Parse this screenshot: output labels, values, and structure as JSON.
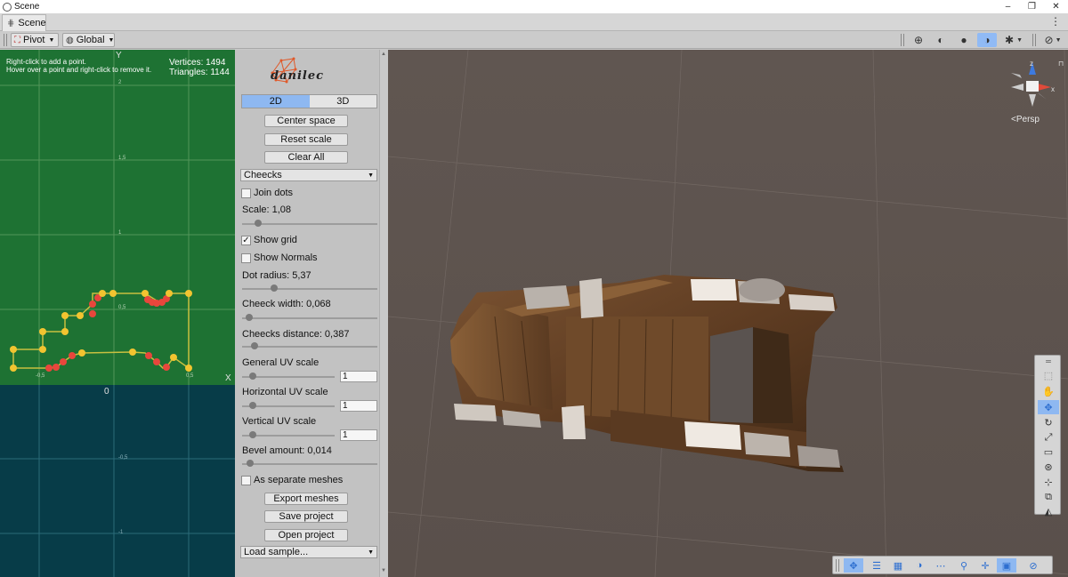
{
  "window": {
    "title": "Scene",
    "buttons": [
      "–",
      "❐",
      "✕"
    ]
  },
  "tab": {
    "label": "Scene",
    "icon": "grid-icon",
    "menu_icon": "⋮"
  },
  "toolbar": {
    "pivot": "Pivot",
    "global": "Global",
    "right_icons": [
      "globe-icon",
      "shaded-sphere-icon",
      "sphere-icon",
      "skybox-icon",
      "gizmo-icon",
      "camera-icon"
    ]
  },
  "editor2d": {
    "hint_line1": "Right-click to add a point.",
    "hint_line2": "Hover over a point and right-click to remove it.",
    "vertices": "Vertices: 1494",
    "triangles": "Triangles: 1144",
    "axis_x": "X",
    "axis_y": "Y",
    "origin": "0",
    "ticks": [
      "2",
      "1,5",
      "1",
      "0,5",
      "-0,5",
      "0,5",
      "-0,5",
      "-1"
    ],
    "colors": {
      "upper": "#1e7233",
      "lower": "#073c48",
      "grid": "#6aa46a",
      "point": "#f2c430",
      "point_red": "#e8463c",
      "line": "#c8c040"
    }
  },
  "panel": {
    "logo": "danilec",
    "mode_2d": "2D",
    "mode_3d": "3D",
    "center_space": "Center space",
    "reset_scale": "Reset scale",
    "clear_all": "Clear All",
    "pattern_select": "Cheecks",
    "join_dots": "Join dots",
    "scale": "Scale: 1,08",
    "scale_level": 0.12,
    "show_grid": "Show grid",
    "show_normals": "Show Normals",
    "dot_radius": "Dot radius: 5,37",
    "dot_radius_level": 0.24,
    "cheeck_width": "Cheeck width: 0,068",
    "cheeck_width_level": 0.05,
    "cheecks_distance": "Cheecks distance: 0,387",
    "cheecks_distance_level": 0.09,
    "general_uv": "General UV scale",
    "general_uv_value": "1",
    "horizontal_uv": "Horizontal UV scale",
    "horizontal_uv_value": "1",
    "vertical_uv": "Vertical UV scale",
    "vertical_uv_value": "1",
    "bevel_amount": "Bevel amount: 0,014",
    "bevel_level": 0.06,
    "separate_meshes": "As separate meshes",
    "export_meshes": "Export meshes",
    "save_project": "Save project",
    "open_project": "Open project",
    "load_sample": "Load sample..."
  },
  "view3d": {
    "persp_label": "Persp",
    "axis_labels": [
      "z",
      "x"
    ]
  }
}
